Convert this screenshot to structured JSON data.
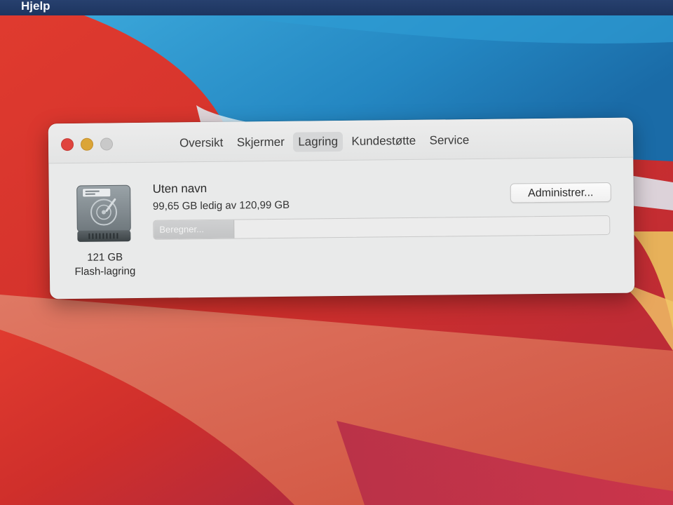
{
  "menubar": {
    "items": [
      "Hjelp"
    ]
  },
  "window": {
    "tabs": [
      "Oversikt",
      "Skjermer",
      "Lagring",
      "Kundestøtte",
      "Service"
    ],
    "active_tab": "Lagring",
    "disk": {
      "size_label": "121 GB",
      "type_label": "Flash-lagring"
    },
    "volume": {
      "name": "Uten navn",
      "free_text": "99,65 GB ledig av 120,99 GB",
      "status_label": "Beregner...",
      "calculated_fraction": 0.175
    },
    "manage_button_label": "Administrer..."
  },
  "colors": {
    "close": "#e0443e",
    "minimize": "#dba536",
    "zoom_inactive": "#c9c9c9",
    "wallpaper_blue": "#2a8fc9",
    "wallpaper_red": "#c8302e"
  },
  "icons": [
    "hard-drive-icon"
  ]
}
